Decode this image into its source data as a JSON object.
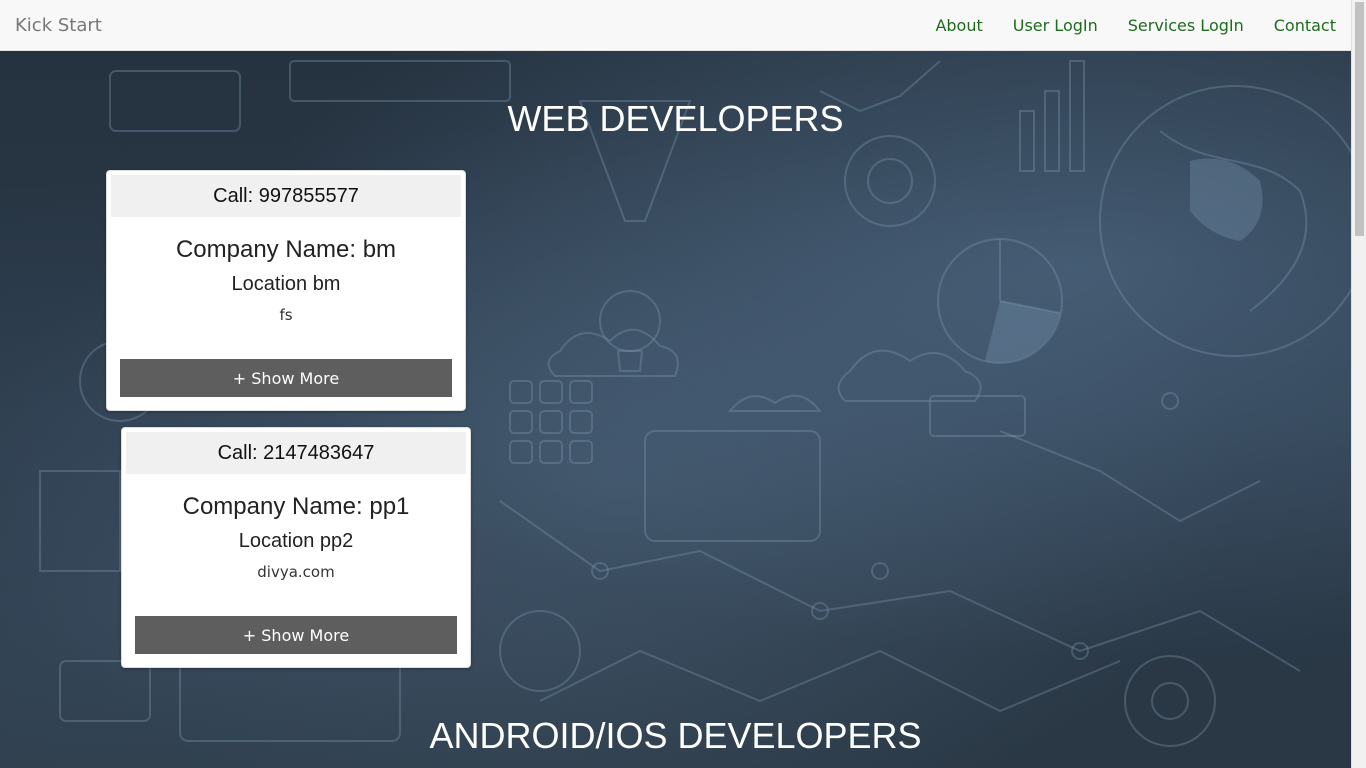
{
  "navbar": {
    "brand": "Kick Start",
    "links": [
      "About",
      "User LogIn",
      "Services LogIn",
      "Contact"
    ]
  },
  "sections": {
    "web_title": "WEB DEVELOPERS",
    "mobile_title": "ANDROID/IOS DEVELOPERS"
  },
  "cards": [
    {
      "call": "Call: 997855577",
      "company": "Company Name: bm",
      "location": "Location bm",
      "website": "fs",
      "button": "+ Show More"
    },
    {
      "call": "Call: 2147483647",
      "company": "Company Name: pp1",
      "location": "Location pp2",
      "website": "divya.com",
      "button": "+ Show More"
    }
  ],
  "colors": {
    "navbar_bg": "#f8f8f8",
    "nav_link": "#1e6b1e",
    "brand": "#777777",
    "button_bg": "#5e5e5e",
    "hero_bg": "#2a3a4a"
  }
}
